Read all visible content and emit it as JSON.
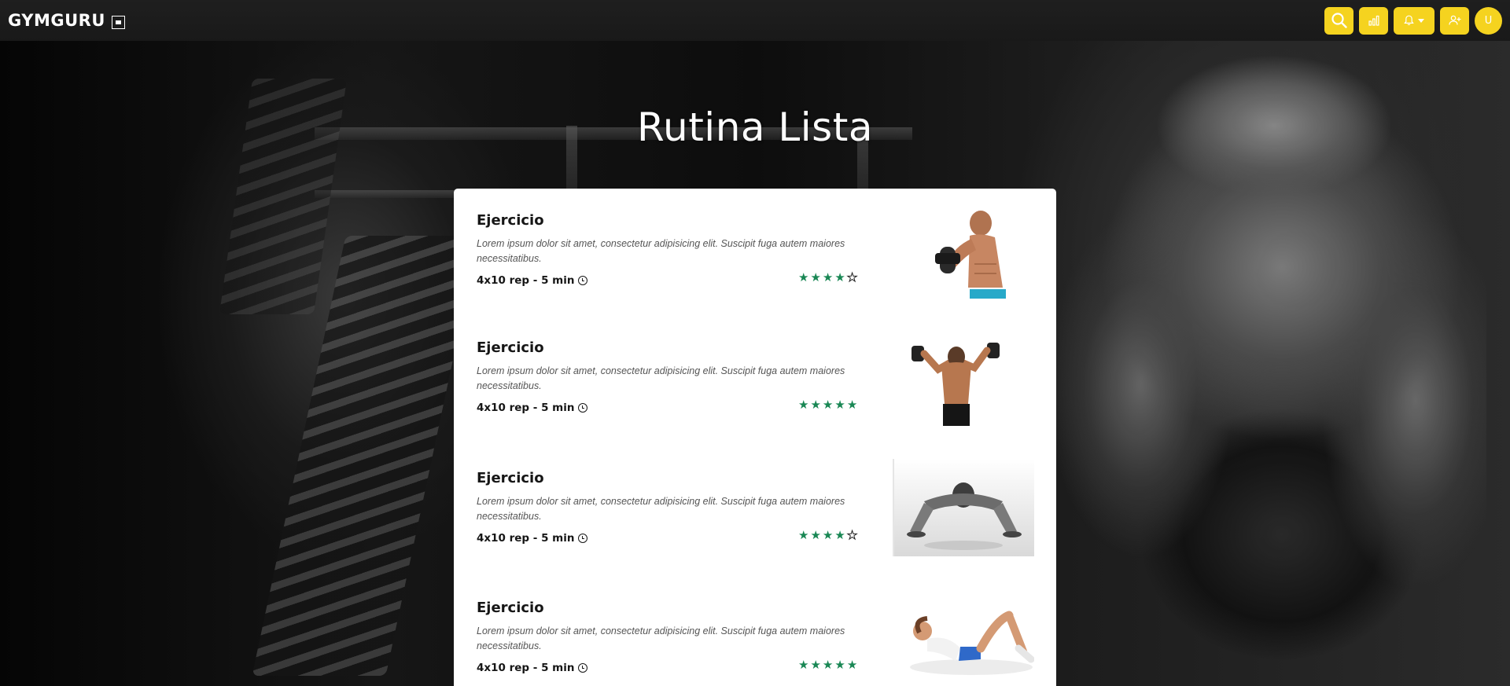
{
  "navbar": {
    "brand": "GYMGURU",
    "avatar_initial": "U",
    "actions": [
      {
        "icon": "search-icon"
      },
      {
        "icon": "chart-icon"
      },
      {
        "icon": "bell-icon",
        "has_dropdown": true
      },
      {
        "icon": "add-user-icon"
      }
    ]
  },
  "page": {
    "title": "Rutina Lista"
  },
  "exercises": [
    {
      "title": "Ejercicio",
      "description": "Lorem ipsum dolor sit amet, consectetur adipisicing elit. Suscipit fuga autem maiores necessitatibus.",
      "meta": "4x10 rep - 5 min",
      "rating": 4,
      "rating_max": 5,
      "image": "bicep-curl-image"
    },
    {
      "title": "Ejercicio",
      "description": "Lorem ipsum dolor sit amet, consectetur adipisicing elit. Suscipit fuga autem maiores necessitatibus.",
      "meta": "4x10 rep - 5 min",
      "rating": 5,
      "rating_max": 5,
      "image": "shoulder-press-image"
    },
    {
      "title": "Ejercicio",
      "description": "Lorem ipsum dolor sit amet, consectetur adipisicing elit. Suscipit fuga autem maiores necessitatibus.",
      "meta": "4x10 rep - 5 min",
      "rating": 4,
      "rating_max": 5,
      "image": "push-up-image"
    },
    {
      "title": "Ejercicio",
      "description": "Lorem ipsum dolor sit amet, consectetur adipisicing elit. Suscipit fuga autem maiores necessitatibus.",
      "meta": "4x10 rep - 5 min",
      "rating": 5,
      "rating_max": 5,
      "image": "crunch-image"
    }
  ],
  "colors": {
    "accent": "#f5d31f",
    "rating_star": "#198754",
    "navbar_bg": "#1c1c1c"
  }
}
